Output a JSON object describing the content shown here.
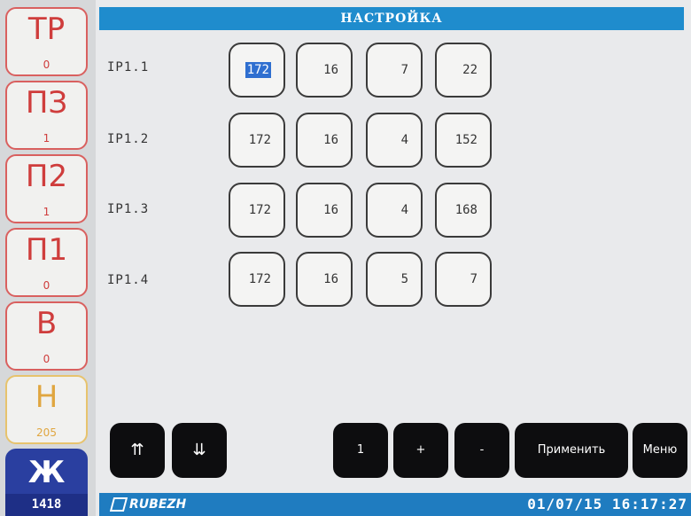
{
  "sidebar": {
    "items": [
      {
        "code": "ТР",
        "count": "0"
      },
      {
        "code": "ПЗ",
        "count": "1"
      },
      {
        "code": "П2",
        "count": "1"
      },
      {
        "code": "П1",
        "count": "0"
      },
      {
        "code": "В",
        "count": "0"
      },
      {
        "code": "Н",
        "count": "205"
      },
      {
        "code": "Ж",
        "count": "1418"
      }
    ]
  },
  "header": {
    "title": "НАСТРОЙКА"
  },
  "ip_rows": [
    {
      "label": "IP1.1",
      "octets": [
        "172",
        "16",
        "7",
        "22"
      ]
    },
    {
      "label": "IP1.2",
      "octets": [
        "172",
        "16",
        "4",
        "152"
      ]
    },
    {
      "label": "IP1.3",
      "octets": [
        "172",
        "16",
        "4",
        "168"
      ]
    },
    {
      "label": "IP1.4",
      "octets": [
        "172",
        "16",
        "5",
        "7"
      ]
    }
  ],
  "toolbar": {
    "up_label": "⇈",
    "down_label": "⇊",
    "step_label": "1",
    "plus_label": "+",
    "minus_label": "-",
    "apply_label": "Применить",
    "menu_label": "Меню"
  },
  "status": {
    "brand": "RUBEZH",
    "datetime": "01/07/15 16:17:27"
  },
  "colors": {
    "title_bar": "#1f8ccd",
    "alarm_red": "#cf3d3c",
    "warning_yellow": "#e0a640",
    "active_blue": "#2a3fa0",
    "selection": "#2f6fd0"
  }
}
